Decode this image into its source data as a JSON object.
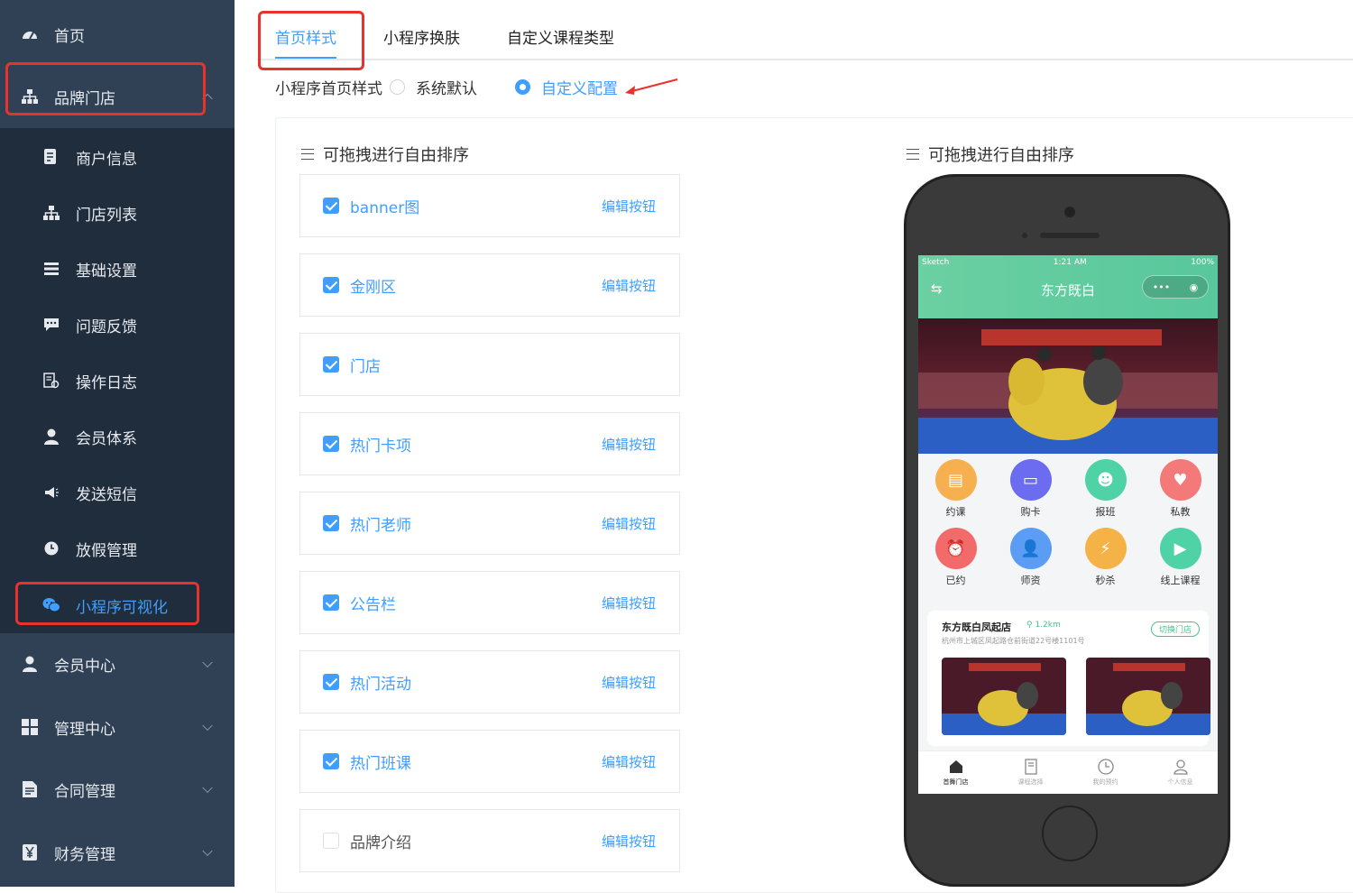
{
  "sidebar": {
    "home": "首页",
    "brand": "品牌门店",
    "sub_items": [
      {
        "label": "商户信息",
        "icon": "file-edit-icon"
      },
      {
        "label": "门店列表",
        "icon": "sitemap-icon"
      },
      {
        "label": "基础设置",
        "icon": "list-icon"
      },
      {
        "label": "问题反馈",
        "icon": "message-icon"
      },
      {
        "label": "操作日志",
        "icon": "log-icon"
      },
      {
        "label": "会员体系",
        "icon": "user-icon"
      },
      {
        "label": "发送短信",
        "icon": "megaphone-icon"
      },
      {
        "label": "放假管理",
        "icon": "clock-icon"
      },
      {
        "label": "小程序可视化",
        "icon": "wechat-icon"
      }
    ],
    "groups": [
      "会员中心",
      "管理中心",
      "合同管理",
      "财务管理"
    ]
  },
  "tabs": [
    "首页样式",
    "小程序换肤",
    "自定义课程类型"
  ],
  "style_row": {
    "label": "小程序首页样式",
    "option_default": "系统默认",
    "option_custom": "自定义配置"
  },
  "section_title": "可拖拽进行自由排序",
  "preview_title": "可拖拽进行自由排序",
  "edit_label": "编辑按钮",
  "modules": [
    {
      "label": "banner图",
      "checked": true,
      "edit": true
    },
    {
      "label": "金刚区",
      "checked": true,
      "edit": true
    },
    {
      "label": "门店",
      "checked": true,
      "edit": false
    },
    {
      "label": "热门卡项",
      "checked": true,
      "edit": true
    },
    {
      "label": "热门老师",
      "checked": true,
      "edit": true
    },
    {
      "label": "公告栏",
      "checked": true,
      "edit": true
    },
    {
      "label": "热门活动",
      "checked": true,
      "edit": true
    },
    {
      "label": "热门班课",
      "checked": true,
      "edit": true
    },
    {
      "label": "品牌介绍",
      "checked": false,
      "edit": true
    }
  ],
  "phone": {
    "carrier": "Sketch",
    "time": "1:21 AM",
    "battery": "100%",
    "title": "东方既白",
    "grid": [
      {
        "label": "约课",
        "color": "#f6b04f"
      },
      {
        "label": "购卡",
        "color": "#6c6cf0"
      },
      {
        "label": "报班",
        "color": "#4fd3a6"
      },
      {
        "label": "私教",
        "color": "#f47a7a"
      },
      {
        "label": "已约",
        "color": "#f26a6a"
      },
      {
        "label": "师资",
        "color": "#5b9cf4"
      },
      {
        "label": "秒杀",
        "color": "#f5b246"
      },
      {
        "label": "线上课程",
        "color": "#4fd3a6"
      }
    ],
    "store_name": "东方既白凤起店",
    "store_distance": "1.2km",
    "store_address": "杭州市上城区凤起路仓前街道22号楼1101号",
    "switch_store": "切换门店",
    "tabbar": [
      "首舞门店",
      "课程选择",
      "我的预约",
      "个人信息"
    ]
  },
  "colors": {
    "sidebar_bg": "#304156",
    "submenu_bg": "#1f2d3d",
    "accent": "#409eff",
    "highlight_box": "#e8322b",
    "mini_program_green": "#58c79c"
  }
}
